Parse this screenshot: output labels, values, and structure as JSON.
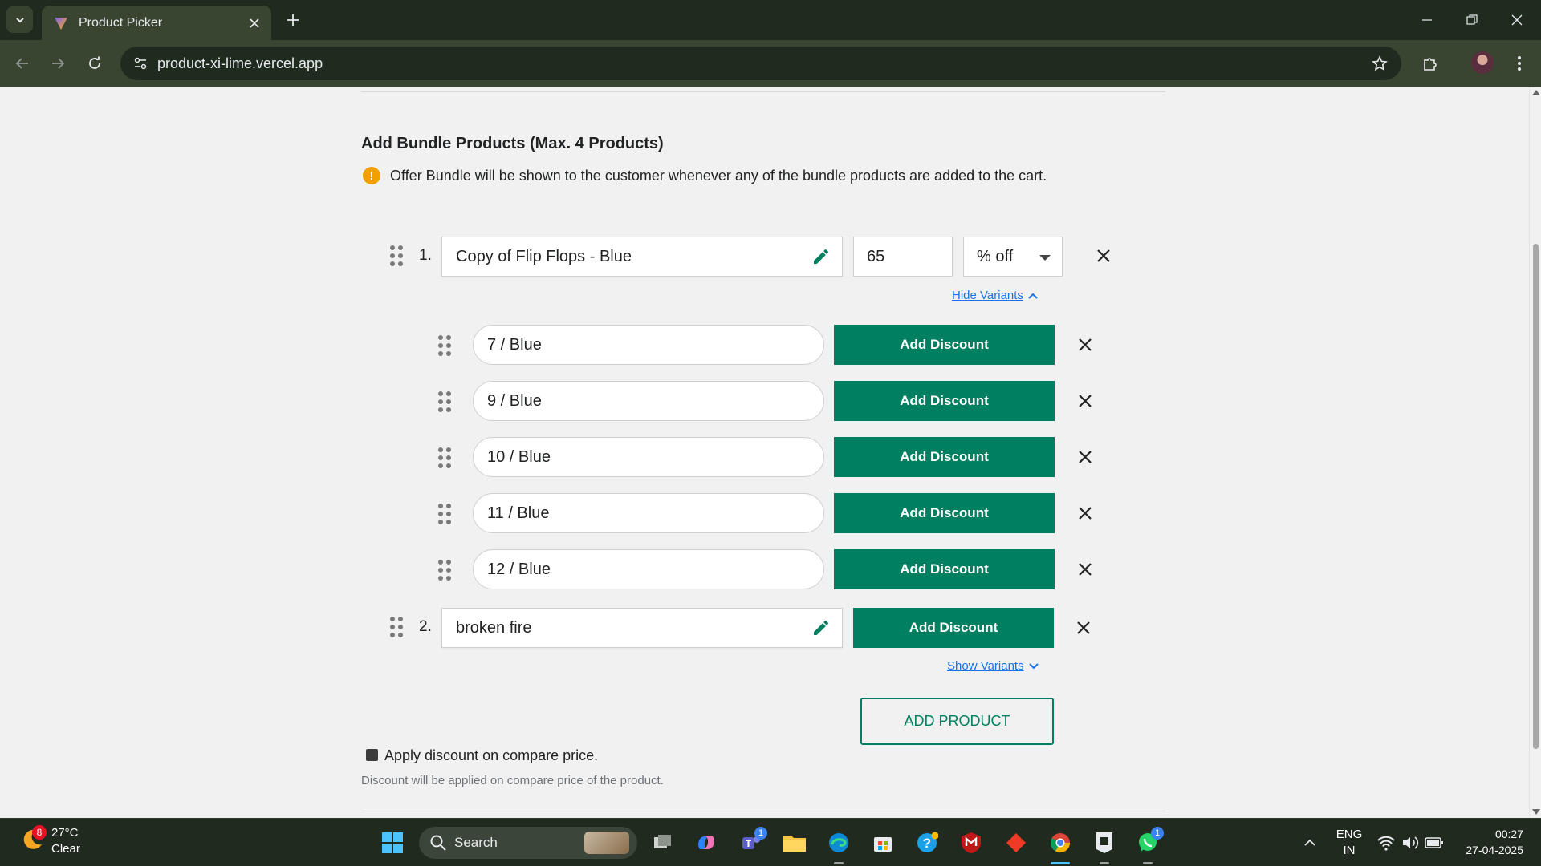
{
  "browser": {
    "tab_title": "Product Picker",
    "url": "product-xi-lime.vercel.app"
  },
  "page": {
    "heading": "Add Bundle Products (Max. 4 Products)",
    "info_text": "Offer Bundle will be shown to the customer whenever any of the bundle products are added to the cart.",
    "products": [
      {
        "index": "1.",
        "name": "Copy of Flip Flops - Blue",
        "discount_value": "65",
        "discount_type": "% off",
        "variants_toggle": "Hide Variants",
        "variants": [
          {
            "name": "7 / Blue",
            "button": "Add Discount"
          },
          {
            "name": "9 / Blue",
            "button": "Add Discount"
          },
          {
            "name": "10 / Blue",
            "button": "Add Discount"
          },
          {
            "name": "11 / Blue",
            "button": "Add Discount"
          },
          {
            "name": "12 / Blue",
            "button": "Add Discount"
          }
        ]
      },
      {
        "index": "2.",
        "name": "broken fire",
        "button": "Add Discount",
        "variants_toggle": "Show Variants"
      }
    ],
    "add_product_button": "ADD PRODUCT",
    "compare_price_label": "Apply discount on compare price.",
    "compare_price_help": "Discount will be applied on compare price of the product.",
    "accent_color": "#008060"
  },
  "taskbar": {
    "weather_badge": "8",
    "temperature": "27°C",
    "condition": "Clear",
    "search_label": "Search",
    "teams_badge": "1",
    "whatsapp_badge": "1",
    "lang_line1": "ENG",
    "lang_line2": "IN",
    "time": "00:27",
    "date": "27-04-2025"
  }
}
